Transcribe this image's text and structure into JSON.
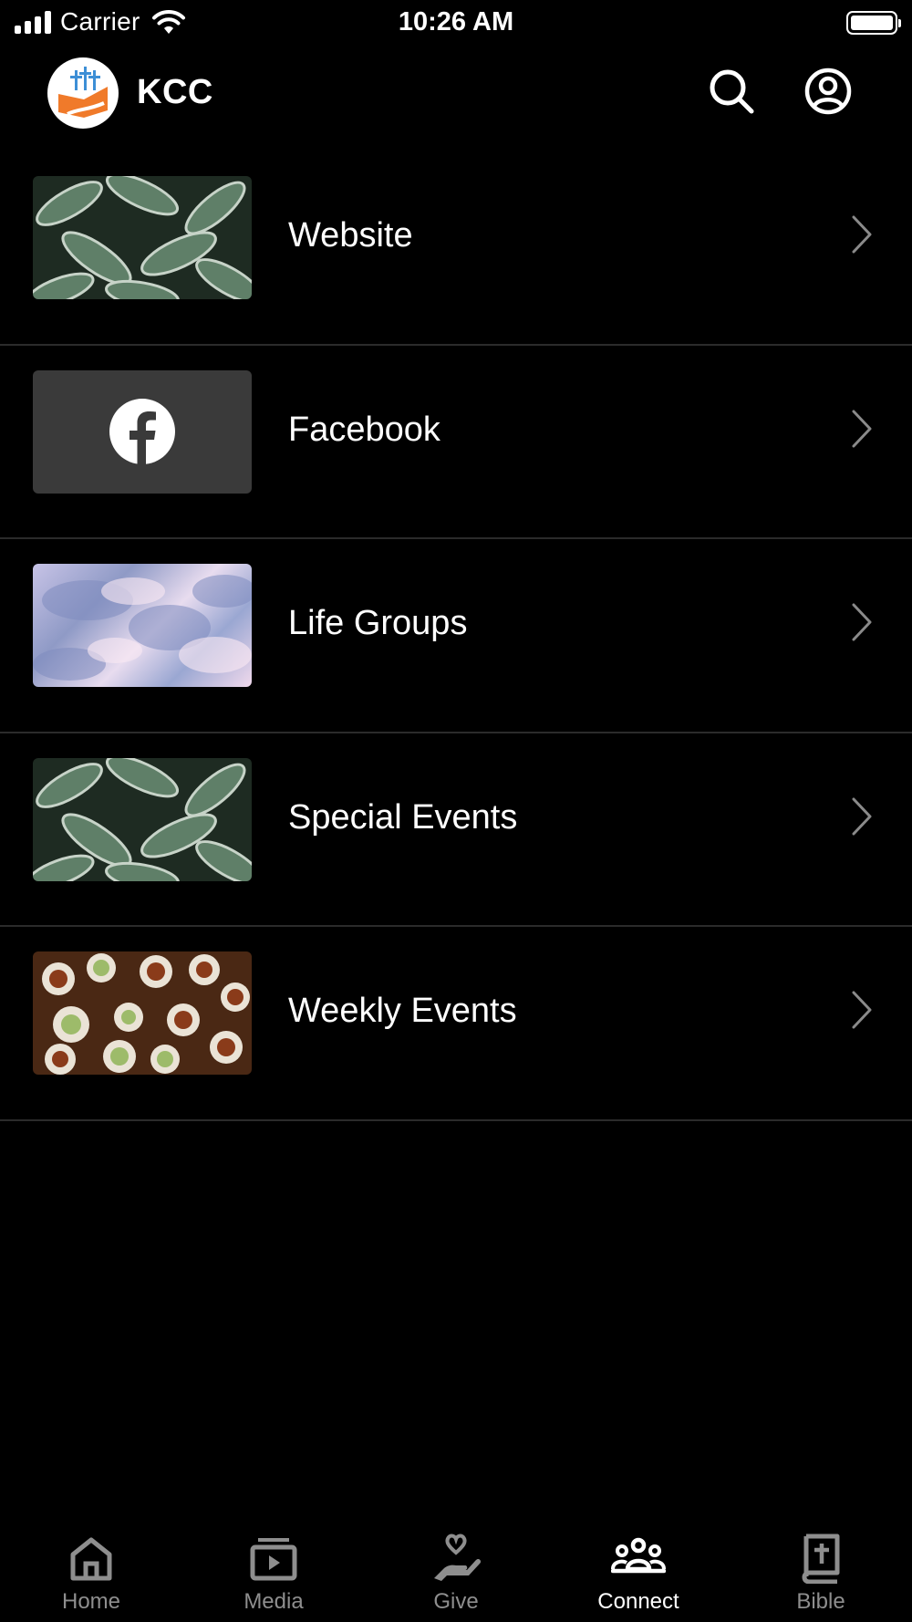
{
  "status_bar": {
    "carrier": "Carrier",
    "time": "10:26 AM"
  },
  "header": {
    "title": "KCC"
  },
  "items": [
    {
      "label": "Website",
      "thumb": "leaves-photo"
    },
    {
      "label": "Facebook",
      "thumb": "facebook-logo"
    },
    {
      "label": "Life Groups",
      "thumb": "sky-photo"
    },
    {
      "label": "Special Events",
      "thumb": "leaves-photo"
    },
    {
      "label": "Weekly Events",
      "thumb": "food-table-photo"
    }
  ],
  "tabs": [
    {
      "label": "Home",
      "icon": "home-icon"
    },
    {
      "label": "Media",
      "icon": "media-icon"
    },
    {
      "label": "Give",
      "icon": "give-icon"
    },
    {
      "label": "Connect",
      "icon": "connect-icon",
      "active": true
    },
    {
      "label": "Bible",
      "icon": "bible-icon"
    }
  ],
  "colors": {
    "background": "#000000",
    "tab_inactive": "#8e8e8e",
    "tab_active": "#ffffff",
    "divider": "#2b2b2b"
  }
}
